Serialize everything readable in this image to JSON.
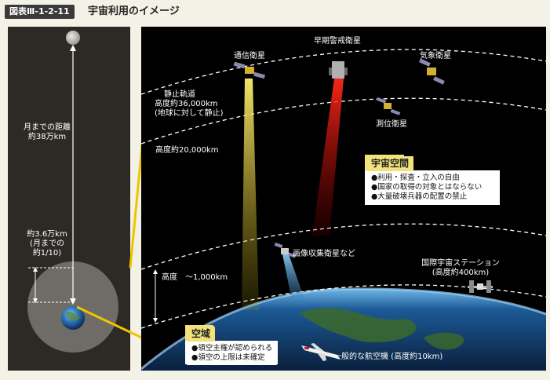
{
  "header": {
    "figure_number": "図表Ⅲ-1-2-11",
    "title": "宇宙利用のイメージ"
  },
  "left_panel": {
    "moon_distance": [
      "月までの距離",
      "約38万km"
    ],
    "geo_distance": [
      "約3.6万km",
      "(月までの",
      "約1/10)"
    ]
  },
  "orbits": {
    "geostationary": [
      "静止軌道",
      "高度約36,000km",
      "(地球に対して静止)"
    ],
    "gps_altitude": "高度約20,000km",
    "low_altitude": "高度　～1,000km"
  },
  "satellites": {
    "communication": "通信衛星",
    "early_warning": "早期警戒衛星",
    "weather": "気象衛星",
    "positioning": "測位衛星",
    "imaging": "画像収集衛星など",
    "iss": [
      "国際宇宙ステーション",
      "(高度約400km)"
    ]
  },
  "space_box": {
    "title": "宇宙空間",
    "items": [
      "●利用・探査・立入の自由",
      "●国家の取得の対象とはならない",
      "●大量破壊兵器の配置の禁止"
    ]
  },
  "airspace_box": {
    "title": "空域",
    "items": [
      "●領空主権が認められる",
      "●領空の上限は未確定"
    ]
  },
  "aircraft": "一般的な航空機 (高度約10km)",
  "colors": {
    "space_background": "#000000",
    "highlight_yellow": "#f0c400",
    "beam_red": "#d81010",
    "beam_yellow": "#e8d020",
    "beam_blue": "#5ab0e0"
  }
}
